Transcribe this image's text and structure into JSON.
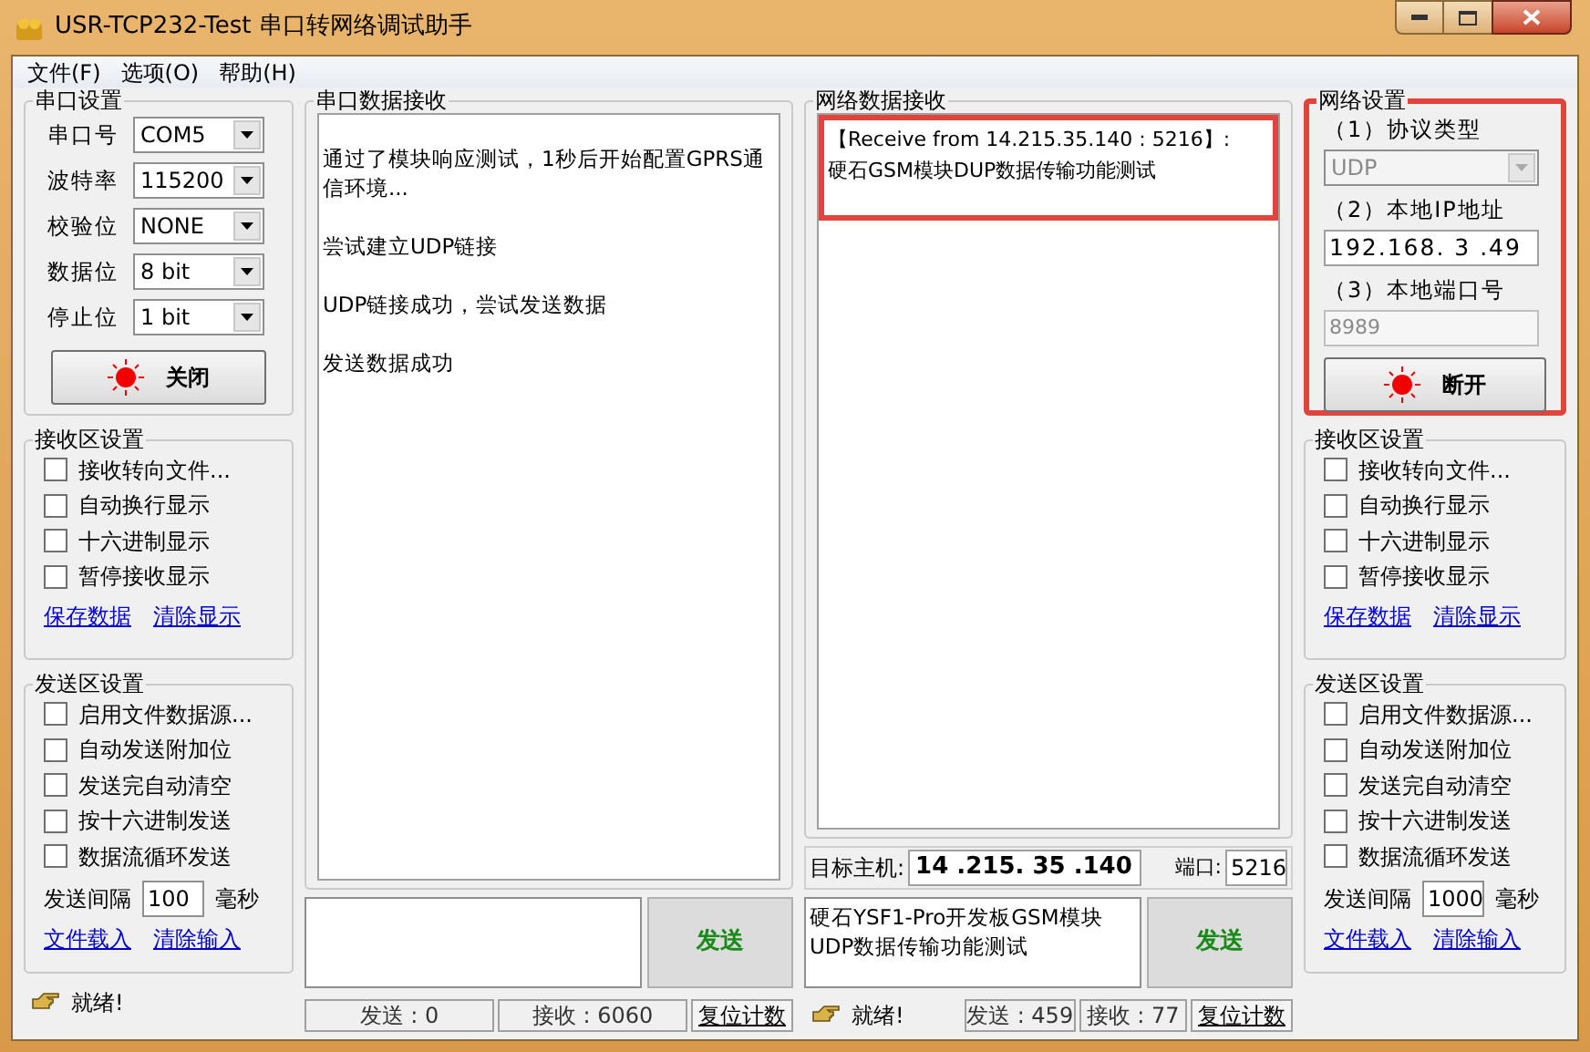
{
  "window": {
    "title": "USR-TCP232-Test 串口转网络调试助手"
  },
  "menu": [
    "文件(F)",
    "选项(O)",
    "帮助(H)"
  ],
  "serial_settings": {
    "title": "串口设置",
    "fields": [
      {
        "label": "串口号",
        "value": "COM5"
      },
      {
        "label": "波特率",
        "value": "115200"
      },
      {
        "label": "校验位",
        "value": "NONE"
      },
      {
        "label": "数据位",
        "value": "8 bit"
      },
      {
        "label": "停止位",
        "value": "1 bit"
      }
    ],
    "button": {
      "label": "关闭",
      "led_on": true
    }
  },
  "left_receive_settings": {
    "title": "接收区设置",
    "options": [
      {
        "label": "接收转向文件...",
        "checked": false
      },
      {
        "label": "自动换行显示",
        "checked": false
      },
      {
        "label": "十六进制显示",
        "checked": false
      },
      {
        "label": "暂停接收显示",
        "checked": false
      }
    ],
    "links": [
      "保存数据",
      "清除显示"
    ]
  },
  "left_send_settings": {
    "title": "发送区设置",
    "options": [
      {
        "label": "启用文件数据源...",
        "checked": false
      },
      {
        "label": "自动发送附加位",
        "checked": false
      },
      {
        "label": "发送完自动清空",
        "checked": false
      },
      {
        "label": "按十六进制发送",
        "checked": false
      },
      {
        "label": "数据流循环发送",
        "checked": false
      }
    ],
    "interval": {
      "label": "发送间隔",
      "value": "100",
      "unit": "毫秒"
    },
    "links": [
      "文件载入",
      "清除输入"
    ]
  },
  "left_status": "就绪!",
  "serial_receive": {
    "title": "串口数据接收",
    "paragraphs": [
      "通过了模块响应测试，1秒后开始配置GPRS通信环境...",
      "尝试建立UDP链接",
      "UDP链接成功，尝试发送数据",
      "发送数据成功"
    ]
  },
  "serial_send": {
    "button": "发送"
  },
  "serial_counters": {
    "sent": "发送 : 0",
    "received": "接收 : 6060",
    "reset": "复位计数"
  },
  "network_receive": {
    "title": "网络数据接收",
    "highlighted": true,
    "lines": [
      "【Receive from 14.215.35.140 : 5216】:",
      "硬石GSM模块DUP数据传输功能测试"
    ]
  },
  "target": {
    "host_label": "目标主机:",
    "host": "14 .215. 35 .140",
    "port_label": "端口:",
    "port": "5216"
  },
  "network_send": {
    "value": "硬石YSF1-Pro开发板GSM模块UDP数据传输功能测试",
    "button": "发送"
  },
  "network_status": "就绪!",
  "network_counters": {
    "sent": "发送 : 459",
    "received": "接收 : 77",
    "reset": "复位计数"
  },
  "network_settings": {
    "title": "网络设置",
    "highlighted": true,
    "protocol_label": "（1）协议类型",
    "protocol": "UDP",
    "protocol_disabled": true,
    "ip_label": "（2）本地IP地址",
    "ip": "192.168. 3 .49",
    "port_label": "（3）本地端口号",
    "port": "8989",
    "port_disabled": true,
    "button": {
      "label": "断开",
      "led_on": true
    }
  },
  "right_receive_settings": {
    "title": "接收区设置",
    "options": [
      {
        "label": "接收转向文件...",
        "checked": false
      },
      {
        "label": "自动换行显示",
        "checked": false
      },
      {
        "label": "十六进制显示",
        "checked": false
      },
      {
        "label": "暂停接收显示",
        "checked": false
      }
    ],
    "links": [
      "保存数据",
      "清除显示"
    ]
  },
  "right_send_settings": {
    "title": "发送区设置",
    "options": [
      {
        "label": "启用文件数据源...",
        "checked": false
      },
      {
        "label": "自动发送附加位",
        "checked": false
      },
      {
        "label": "发送完自动清空",
        "checked": false
      },
      {
        "label": "按十六进制发送",
        "checked": false
      },
      {
        "label": "数据流循环发送",
        "checked": false
      }
    ],
    "interval": {
      "label": "发送间隔",
      "value": "1000",
      "unit": "毫秒"
    },
    "links": [
      "文件载入",
      "清除输入"
    ]
  }
}
